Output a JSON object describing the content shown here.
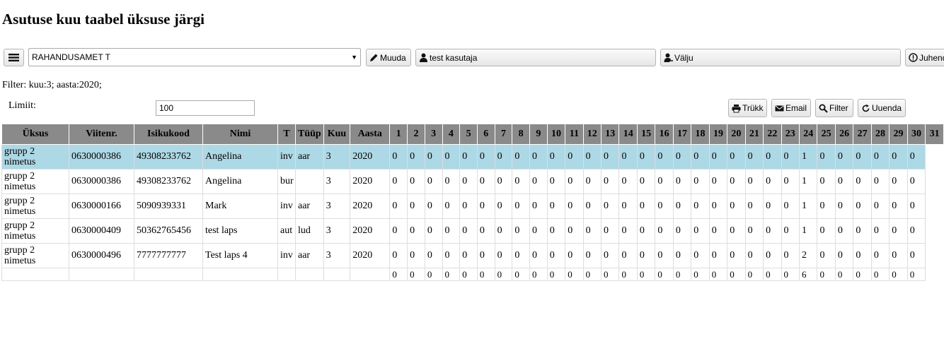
{
  "page": {
    "title": "Asutuse kuu taabel üksuse järgi"
  },
  "toolbar": {
    "org_select": "RAHANDUSAMET T",
    "edit_label": "Muuda",
    "user_label": "test kasutaja",
    "logout_label": "Välju",
    "help_label": "Juhend"
  },
  "filter_text": "Filter: kuu:3; aasta:2020;",
  "limit": {
    "label": "Limiit:",
    "value": "100"
  },
  "actions": {
    "print": "Trükk",
    "email": "Email",
    "filter": "Filter",
    "refresh": "Uuenda"
  },
  "left_headers": [
    "Üksus",
    "Viitenr.",
    "Isikukood",
    "Nimi",
    "T"
  ],
  "right_headers": [
    "Tüüp",
    "Kuu",
    "Aasta",
    "1",
    "2",
    "3",
    "4",
    "5",
    "6",
    "7",
    "8",
    "9",
    "10",
    "11",
    "12",
    "13",
    "14",
    "15",
    "16",
    "17",
    "18",
    "19",
    "20",
    "21",
    "22",
    "23",
    "24",
    "25",
    "26",
    "27",
    "28",
    "29",
    "30",
    "31"
  ],
  "rows": [
    {
      "unit": "grupp 2 nimetus",
      "ref": "0630000386",
      "id": "49308233762",
      "name": "Angelina",
      "type_l": "inv",
      "type_r": "aar",
      "month": "3",
      "year": "2020",
      "days": [
        "0",
        "0",
        "0",
        "0",
        "0",
        "0",
        "0",
        "0",
        "0",
        "0",
        "0",
        "0",
        "0",
        "0",
        "0",
        "0",
        "0",
        "0",
        "0",
        "0",
        "0",
        "0",
        "0",
        "1",
        "0",
        "0",
        "0",
        "0",
        "0",
        "0"
      ],
      "selected": true
    },
    {
      "unit": "grupp 2 nimetus",
      "ref": "0630000386",
      "id": "49308233762",
      "name": "Angelina",
      "type_l": "bur",
      "type_r": "",
      "month": "3",
      "year": "2020",
      "days": [
        "0",
        "0",
        "0",
        "0",
        "0",
        "0",
        "0",
        "0",
        "0",
        "0",
        "0",
        "0",
        "0",
        "0",
        "0",
        "0",
        "0",
        "0",
        "0",
        "0",
        "0",
        "0",
        "0",
        "1",
        "0",
        "0",
        "0",
        "0",
        "0",
        "0"
      ]
    },
    {
      "unit": "grupp 2 nimetus",
      "ref": "0630000166",
      "id": "5090939331",
      "name": "Mark",
      "type_l": "inv",
      "type_r": "aar",
      "month": "3",
      "year": "2020",
      "days": [
        "0",
        "0",
        "0",
        "0",
        "0",
        "0",
        "0",
        "0",
        "0",
        "0",
        "0",
        "0",
        "0",
        "0",
        "0",
        "0",
        "0",
        "0",
        "0",
        "0",
        "0",
        "0",
        "0",
        "1",
        "0",
        "0",
        "0",
        "0",
        "0",
        "0"
      ]
    },
    {
      "unit": "grupp 2 nimetus",
      "ref": "0630000409",
      "id": "50362765456",
      "name": "test laps",
      "type_l": "aut",
      "type_r": "lud",
      "month": "3",
      "year": "2020",
      "days": [
        "0",
        "0",
        "0",
        "0",
        "0",
        "0",
        "0",
        "0",
        "0",
        "0",
        "0",
        "0",
        "0",
        "0",
        "0",
        "0",
        "0",
        "0",
        "0",
        "0",
        "0",
        "0",
        "0",
        "1",
        "0",
        "0",
        "0",
        "0",
        "0",
        "0"
      ]
    },
    {
      "unit": "grupp 2 nimetus",
      "ref": "0630000496",
      "id": "7777777777",
      "name": "Test laps 4",
      "type_l": "inv",
      "type_r": "aar",
      "month": "3",
      "year": "2020",
      "days": [
        "0",
        "0",
        "0",
        "0",
        "0",
        "0",
        "0",
        "0",
        "0",
        "0",
        "0",
        "0",
        "0",
        "0",
        "0",
        "0",
        "0",
        "0",
        "0",
        "0",
        "0",
        "0",
        "0",
        "2",
        "0",
        "0",
        "0",
        "0",
        "0",
        "0"
      ]
    }
  ],
  "totals": [
    "0",
    "0",
    "0",
    "0",
    "0",
    "0",
    "0",
    "0",
    "0",
    "0",
    "0",
    "0",
    "0",
    "0",
    "0",
    "0",
    "0",
    "0",
    "0",
    "0",
    "0",
    "0",
    "0",
    "6",
    "0",
    "0",
    "0",
    "0",
    "0",
    "0"
  ]
}
